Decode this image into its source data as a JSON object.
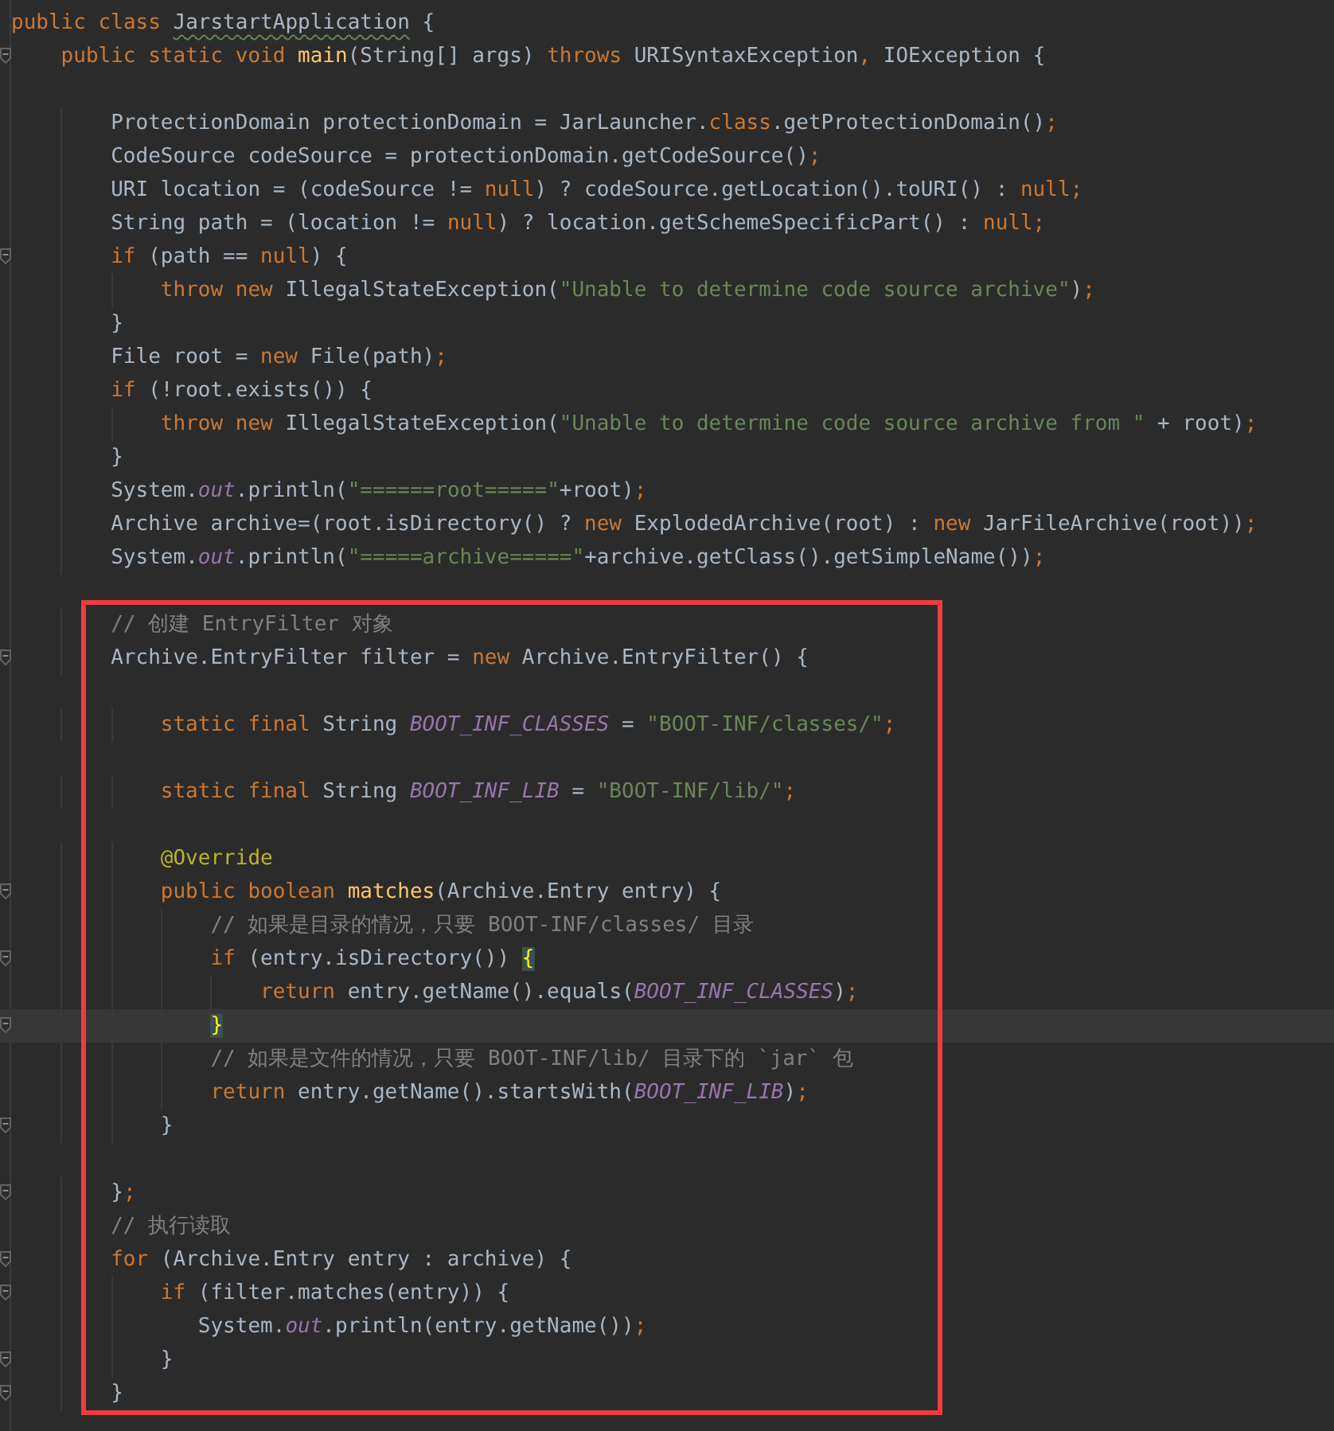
{
  "editor": {
    "lines": [
      {
        "fold": false,
        "current": false,
        "tokens": [
          {
            "kind": "keyword",
            "text": "public class "
          },
          {
            "kind": "typo",
            "text": "JarstartApplication"
          },
          {
            "kind": "plain",
            "text": " {"
          }
        ]
      },
      {
        "fold": true,
        "current": false,
        "tokens": [
          {
            "kind": "keyword",
            "text": "    public static void "
          },
          {
            "kind": "method",
            "text": "main"
          },
          {
            "kind": "plain",
            "text": "(String[] args) "
          },
          {
            "kind": "keyword",
            "text": "throws "
          },
          {
            "kind": "plain",
            "text": "URISyntaxException"
          },
          {
            "kind": "keyword",
            "text": ", "
          },
          {
            "kind": "plain",
            "text": "IOException {"
          }
        ]
      },
      {
        "fold": false,
        "current": false
      },
      {
        "fold": false,
        "current": false,
        "tokens": [
          {
            "kind": "plain",
            "text": "        ProtectionDomain protectionDomain = JarLauncher."
          },
          {
            "kind": "keyword",
            "text": "class"
          },
          {
            "kind": "plain",
            "text": ".getProtectionDomain()"
          },
          {
            "kind": "keyword",
            "text": ";"
          }
        ]
      },
      {
        "fold": false,
        "current": false,
        "tokens": [
          {
            "kind": "plain",
            "text": "        CodeSource codeSource = protectionDomain.getCodeSource()"
          },
          {
            "kind": "keyword",
            "text": ";"
          }
        ]
      },
      {
        "fold": false,
        "current": false,
        "tokens": [
          {
            "kind": "plain",
            "text": "        URI location = (codeSource != "
          },
          {
            "kind": "keyword",
            "text": "null"
          },
          {
            "kind": "plain",
            "text": ") ? codeSource.getLocation().toURI() : "
          },
          {
            "kind": "keyword",
            "text": "null;"
          }
        ]
      },
      {
        "fold": false,
        "current": false,
        "tokens": [
          {
            "kind": "plain",
            "text": "        String path = (location != "
          },
          {
            "kind": "keyword",
            "text": "null"
          },
          {
            "kind": "plain",
            "text": ") ? location.getSchemeSpecificPart() : "
          },
          {
            "kind": "keyword",
            "text": "null;"
          }
        ]
      },
      {
        "fold": true,
        "current": false,
        "tokens": [
          {
            "kind": "keyword",
            "text": "        if "
          },
          {
            "kind": "plain",
            "text": "(path == "
          },
          {
            "kind": "keyword",
            "text": "null"
          },
          {
            "kind": "plain",
            "text": ") {"
          }
        ]
      },
      {
        "fold": false,
        "current": false,
        "tokens": [
          {
            "kind": "keyword",
            "text": "            throw new "
          },
          {
            "kind": "plain",
            "text": "IllegalStateException("
          },
          {
            "kind": "string",
            "text": "\"Unable to determine code source archive\""
          },
          {
            "kind": "plain",
            "text": ")"
          },
          {
            "kind": "keyword",
            "text": ";"
          }
        ]
      },
      {
        "fold": false,
        "current": false,
        "tokens": [
          {
            "kind": "plain",
            "text": "        }"
          }
        ]
      },
      {
        "fold": false,
        "current": false,
        "tokens": [
          {
            "kind": "plain",
            "text": "        File root = "
          },
          {
            "kind": "keyword",
            "text": "new "
          },
          {
            "kind": "plain",
            "text": "File(path)"
          },
          {
            "kind": "keyword",
            "text": ";"
          }
        ]
      },
      {
        "fold": false,
        "current": false,
        "tokens": [
          {
            "kind": "keyword",
            "text": "        if "
          },
          {
            "kind": "plain",
            "text": "(!root.exists()) {"
          }
        ]
      },
      {
        "fold": false,
        "current": false,
        "tokens": [
          {
            "kind": "keyword",
            "text": "            throw new "
          },
          {
            "kind": "plain",
            "text": "IllegalStateException("
          },
          {
            "kind": "string",
            "text": "\"Unable to determine code source archive from \""
          },
          {
            "kind": "plain",
            "text": " + root)"
          },
          {
            "kind": "keyword",
            "text": ";"
          }
        ]
      },
      {
        "fold": false,
        "current": false,
        "tokens": [
          {
            "kind": "plain",
            "text": "        }"
          }
        ]
      },
      {
        "fold": false,
        "current": false,
        "tokens": [
          {
            "kind": "plain",
            "text": "        System."
          },
          {
            "kind": "field",
            "text": "out"
          },
          {
            "kind": "plain",
            "text": ".println("
          },
          {
            "kind": "string",
            "text": "\"======root=====\""
          },
          {
            "kind": "plain",
            "text": "+root)"
          },
          {
            "kind": "keyword",
            "text": ";"
          }
        ]
      },
      {
        "fold": false,
        "current": false,
        "tokens": [
          {
            "kind": "plain",
            "text": "        Archive archive=(root.isDirectory() ? "
          },
          {
            "kind": "keyword",
            "text": "new "
          },
          {
            "kind": "plain",
            "text": "ExplodedArchive(root) : "
          },
          {
            "kind": "keyword",
            "text": "new "
          },
          {
            "kind": "plain",
            "text": "JarFileArchive(root))"
          },
          {
            "kind": "keyword",
            "text": ";"
          }
        ]
      },
      {
        "fold": false,
        "current": false,
        "tokens": [
          {
            "kind": "plain",
            "text": "        System."
          },
          {
            "kind": "field",
            "text": "out"
          },
          {
            "kind": "plain",
            "text": ".println("
          },
          {
            "kind": "string",
            "text": "\"=====archive=====\""
          },
          {
            "kind": "plain",
            "text": "+archive.getClass().getSimpleName())"
          },
          {
            "kind": "keyword",
            "text": ";"
          }
        ]
      },
      {
        "fold": false,
        "current": false
      }
    ],
    "highlighted_block": {
      "lines": [
        {
          "fold": false,
          "current": false,
          "tokens": [
            {
              "kind": "comment",
              "text": "        // 创建 EntryFilter 对象"
            }
          ]
        },
        {
          "fold": true,
          "current": false,
          "tokens": [
            {
              "kind": "plain",
              "text": "        Archive.EntryFilter filter = "
            },
            {
              "kind": "keyword",
              "text": "new "
            },
            {
              "kind": "plain",
              "text": "Archive.EntryFilter() {"
            }
          ]
        },
        {
          "fold": false,
          "current": false
        },
        {
          "fold": false,
          "current": false,
          "tokens": [
            {
              "kind": "keyword",
              "text": "            static final "
            },
            {
              "kind": "plain",
              "text": "String "
            },
            {
              "kind": "field",
              "text": "BOOT_INF_CLASSES"
            },
            {
              "kind": "plain",
              "text": " = "
            },
            {
              "kind": "string",
              "text": "\"BOOT-INF/classes/\""
            },
            {
              "kind": "keyword",
              "text": ";"
            }
          ]
        },
        {
          "fold": false,
          "current": false
        },
        {
          "fold": false,
          "current": false,
          "tokens": [
            {
              "kind": "keyword",
              "text": "            static final "
            },
            {
              "kind": "plain",
              "text": "String "
            },
            {
              "kind": "field",
              "text": "BOOT_INF_LIB"
            },
            {
              "kind": "plain",
              "text": " = "
            },
            {
              "kind": "string",
              "text": "\"BOOT-INF/lib/\""
            },
            {
              "kind": "keyword",
              "text": ";"
            }
          ]
        },
        {
          "fold": false,
          "current": false
        },
        {
          "fold": false,
          "current": false,
          "tokens": [
            {
              "kind": "annotation",
              "text": "            @Override"
            }
          ]
        },
        {
          "fold": true,
          "current": false,
          "tokens": [
            {
              "kind": "keyword",
              "text": "            public boolean "
            },
            {
              "kind": "method",
              "text": "matches"
            },
            {
              "kind": "plain",
              "text": "(Archive.Entry entry) {"
            }
          ]
        },
        {
          "fold": false,
          "current": false,
          "tokens": [
            {
              "kind": "comment",
              "text": "                // 如果是目录的情况，只要 BOOT-INF/classes/ 目录"
            }
          ]
        },
        {
          "fold": true,
          "current": false,
          "tokens": [
            {
              "kind": "keyword",
              "text": "                if "
            },
            {
              "kind": "plain",
              "text": "(entry.isDirectory()) "
            },
            {
              "kind": "brace",
              "text": "{"
            }
          ]
        },
        {
          "fold": false,
          "current": false,
          "tokens": [
            {
              "kind": "keyword",
              "text": "                    return "
            },
            {
              "kind": "plain",
              "text": "entry.getName().equals("
            },
            {
              "kind": "field",
              "text": "BOOT_INF_CLASSES"
            },
            {
              "kind": "plain",
              "text": ")"
            },
            {
              "kind": "keyword",
              "text": ";"
            }
          ]
        },
        {
          "fold": true,
          "current": true,
          "tokens": [
            {
              "kind": "brace",
              "text": "                }"
            }
          ]
        },
        {
          "fold": false,
          "current": false,
          "tokens": [
            {
              "kind": "comment",
              "text": "                // 如果是文件的情况，只要 BOOT-INF/lib/ 目录下的 `jar` 包"
            }
          ]
        },
        {
          "fold": false,
          "current": false,
          "tokens": [
            {
              "kind": "keyword",
              "text": "                return "
            },
            {
              "kind": "plain",
              "text": "entry.getName().startsWith("
            },
            {
              "kind": "field",
              "text": "BOOT_INF_LIB"
            },
            {
              "kind": "plain",
              "text": ")"
            },
            {
              "kind": "keyword",
              "text": ";"
            }
          ]
        },
        {
          "fold": true,
          "current": false,
          "tokens": [
            {
              "kind": "plain",
              "text": "            }"
            }
          ]
        },
        {
          "fold": false,
          "current": false
        },
        {
          "fold": true,
          "current": false,
          "tokens": [
            {
              "kind": "plain",
              "text": "        }"
            },
            {
              "kind": "keyword",
              "text": ";"
            }
          ]
        },
        {
          "fold": false,
          "current": false,
          "tokens": [
            {
              "kind": "comment",
              "text": "        // 执行读取"
            }
          ]
        },
        {
          "fold": true,
          "current": false,
          "tokens": [
            {
              "kind": "keyword",
              "text": "        for "
            },
            {
              "kind": "plain",
              "text": "(Archive.Entry entry : archive) {"
            }
          ]
        },
        {
          "fold": true,
          "current": false,
          "tokens": [
            {
              "kind": "keyword",
              "text": "            if "
            },
            {
              "kind": "plain",
              "text": "(filter.matches(entry)) {"
            }
          ]
        },
        {
          "fold": false,
          "current": false,
          "tokens": [
            {
              "kind": "plain",
              "text": "               System."
            },
            {
              "kind": "field",
              "text": "out"
            },
            {
              "kind": "plain",
              "text": ".println(entry.getName())"
            },
            {
              "kind": "keyword",
              "text": ";"
            }
          ]
        },
        {
          "fold": true,
          "current": false,
          "tokens": [
            {
              "kind": "plain",
              "text": "            }"
            }
          ]
        },
        {
          "fold": true,
          "current": false,
          "tokens": [
            {
              "kind": "plain",
              "text": "        }"
            }
          ]
        }
      ]
    }
  }
}
